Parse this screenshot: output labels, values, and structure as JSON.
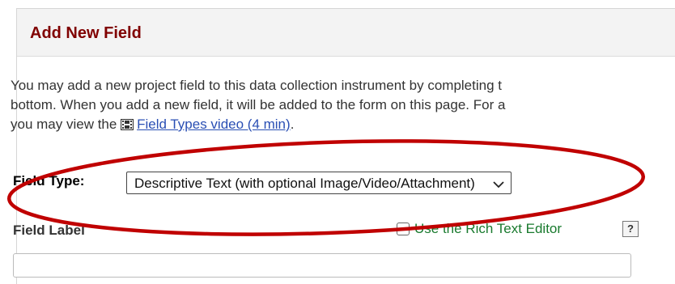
{
  "dialog": {
    "title": "Add New Field",
    "intro_lines": [
      "You may add a new project field to this data collection instrument by completing t",
      "bottom. When you add a new field, it will be added to the form on this page. For a"
    ],
    "intro_line3_prefix": "you may view the",
    "video_link": "Field Types video (4 min)",
    "intro_line3_suffix": "."
  },
  "field_type": {
    "label": "Field Type:",
    "selected": "Descriptive Text (with optional Image/Video/Attachment)"
  },
  "field_label": {
    "label": "Field Label",
    "rich_text_label": "Use the Rich Text Editor",
    "help": "?"
  },
  "colors": {
    "title": "#800000",
    "link": "#2a4fb4",
    "rich_text": "#197a2e",
    "annotation": "#c00000"
  },
  "icons": {
    "video": "film-icon",
    "select": "chevron-down-icon"
  }
}
